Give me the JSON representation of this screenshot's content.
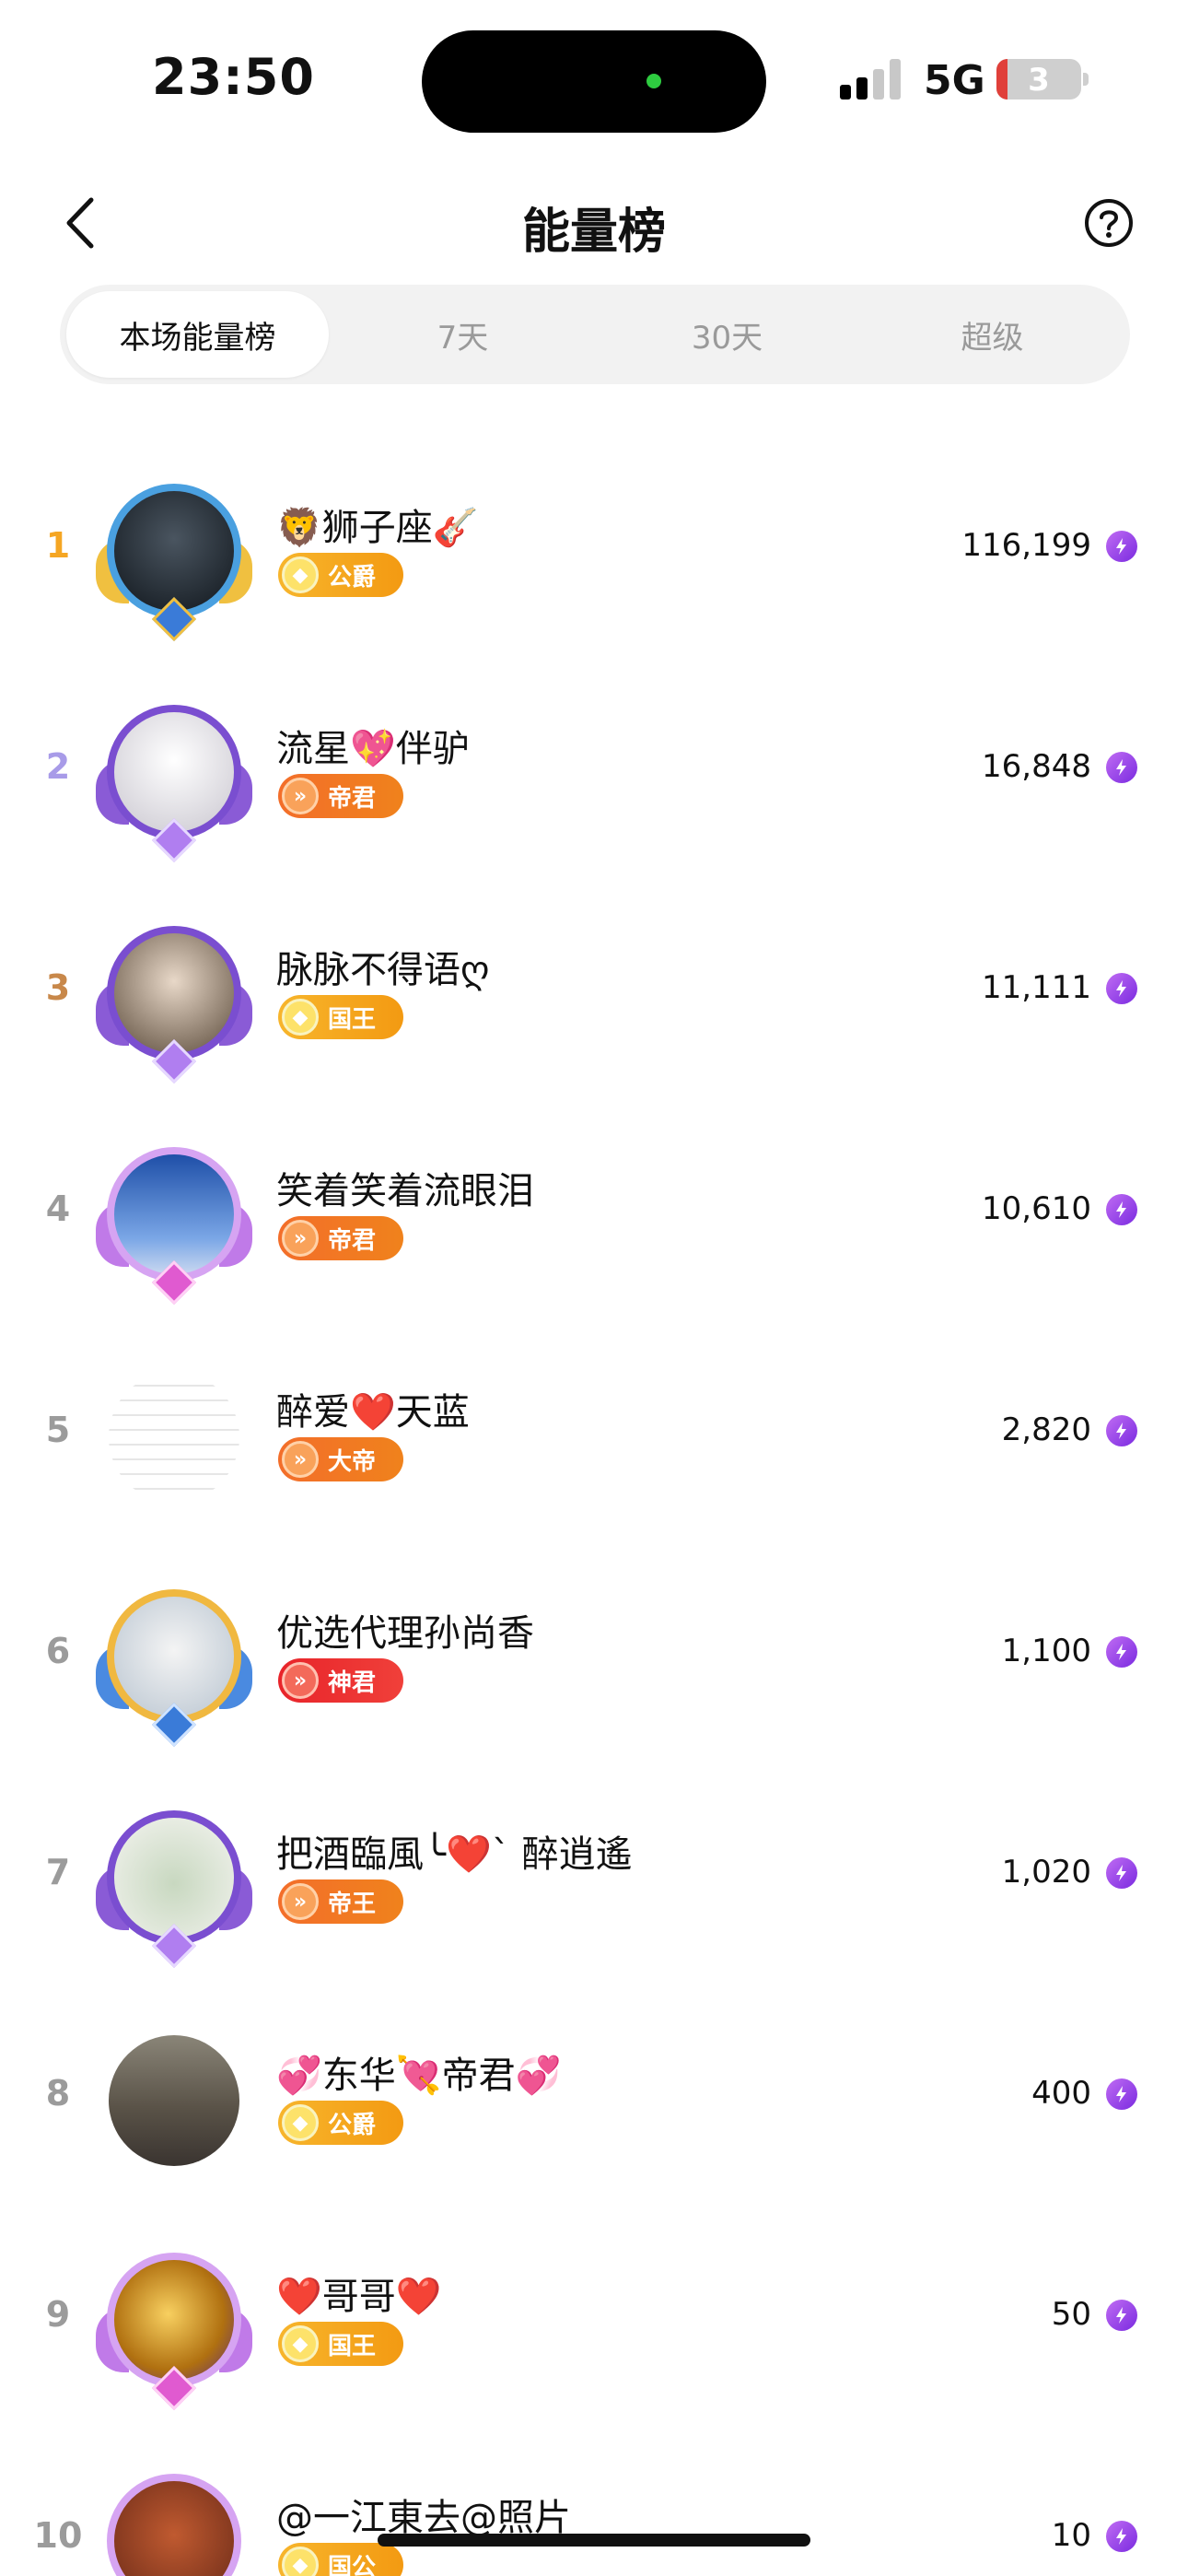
{
  "status_bar": {
    "time": "23:50",
    "network": "5G",
    "battery": "3"
  },
  "header": {
    "title": "能量榜",
    "back_icon": "chevron-left-icon",
    "help_icon": "question-circle-icon"
  },
  "tabs": [
    {
      "label": "本场能量榜",
      "active": true
    },
    {
      "label": "7天",
      "active": false
    },
    {
      "label": "30天",
      "active": false
    },
    {
      "label": "超级",
      "active": false
    }
  ],
  "rows": [
    {
      "rank": "1",
      "name": "🦁狮子座🎸",
      "badge": "公爵",
      "score": "116,199"
    },
    {
      "rank": "2",
      "name": "流星💖伴驴",
      "badge": "帝君",
      "score": "16,848"
    },
    {
      "rank": "3",
      "name": "脉脉不得语ღ",
      "badge": "国王",
      "score": "11,111"
    },
    {
      "rank": "4",
      "name": "笑着笑着流眼泪",
      "badge": "帝君",
      "score": "10,610"
    },
    {
      "rank": "5",
      "name": "醉爱❤️天蓝",
      "badge": "大帝",
      "score": "2,820"
    },
    {
      "rank": "6",
      "name": "优选代理孙尚香",
      "badge": "神君",
      "score": "1,100"
    },
    {
      "rank": "7",
      "name": "把酒臨風╰❤️ˋ 醉逍遙",
      "badge": "帝王",
      "score": "1,020"
    },
    {
      "rank": "8",
      "name": "💞东华💘帝君💞",
      "badge": "公爵",
      "score": "400"
    },
    {
      "rank": "9",
      "name": "❤️哥哥❤️",
      "badge": "国王",
      "score": "50"
    },
    {
      "rank": "10",
      "name": "@一江東去@照片",
      "badge": "国公",
      "score": "10"
    }
  ],
  "colors": {
    "rank_1": "#f5a623",
    "rank_2": "#a89be8",
    "rank_3": "#c8884a",
    "rank_default": "#9b9b9b",
    "energy": "#8a3be6",
    "tab_bg": "#f2f2f2"
  }
}
